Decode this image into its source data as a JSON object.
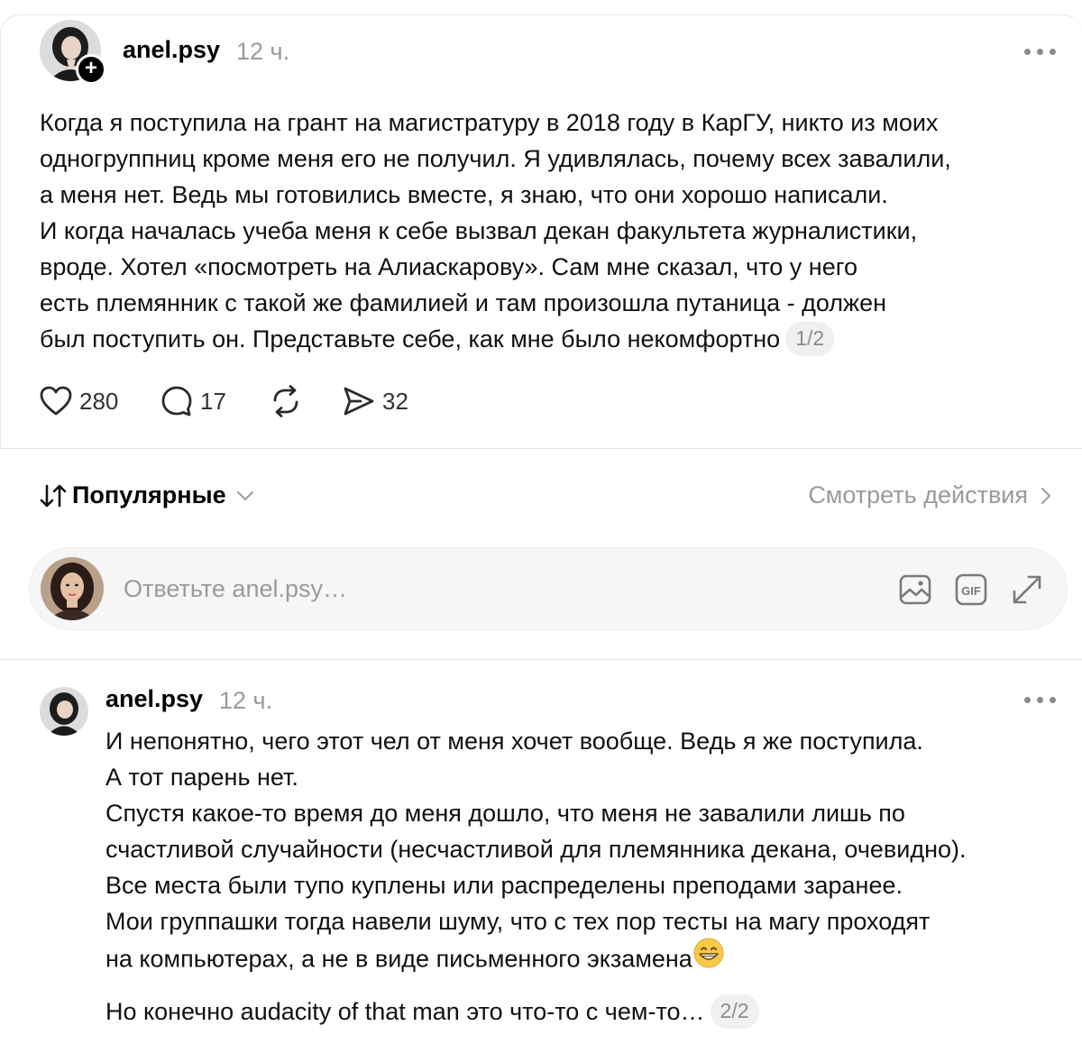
{
  "post": {
    "username": "anel.psy",
    "time": "12 ч.",
    "lines": [
      "Когда я поступила на грант на магистратуру в 2018 году в КарГУ, никто из моих",
      "одногруппниц кроме меня его не получил. Я удивлялась, почему всех завалили,",
      "а меня нет. Ведь мы готовились вместе, я знаю, что они хорошо написали.",
      "И когда началась учеба меня к себе вызвал декан факультета журналистики,",
      "вроде. Хотел «посмотреть на Алиаскарову». Сам мне сказал, что у него",
      "есть племянник с такой же фамилией и там произошла путаница - должен",
      "был поступить он. Представьте себе, как мне было некомфортно"
    ],
    "page_indicator": "1/2",
    "likes": "280",
    "comments": "17",
    "shares": "32"
  },
  "sort": {
    "label": "Популярные",
    "activity_link": "Смотреть действия"
  },
  "reply": {
    "placeholder": "Ответьте anel.psy…"
  },
  "thread_reply": {
    "username": "anel.psy",
    "time": "12 ч.",
    "lines": [
      "И непонятно, чего этот чел от меня хочет вообще. Ведь я же поступила.",
      "А тот парень нет.",
      "Спустя какое-то время до меня дошло, что меня не завалили лишь по",
      "счастливой случайности (несчастливой для племянника декана, очевидно).",
      "Все места были тупо куплены или распределены преподами заранее.",
      "Мои группашки тогда навели шуму, что с тех пор тесты на магу проходят",
      "на компьютерах, а не в виде письменного экзамена"
    ],
    "last_line": "Но конечно audacity of that man это что-то с чем-то…",
    "page_indicator": "2/2"
  },
  "icons": {
    "like": "heart-icon",
    "comment": "comment-icon",
    "repost": "repost-icon",
    "share": "share-icon",
    "image": "image-icon",
    "gif": "gif-icon",
    "expand": "expand-icon",
    "more": "more-icon",
    "sort": "sort-arrows-icon"
  }
}
